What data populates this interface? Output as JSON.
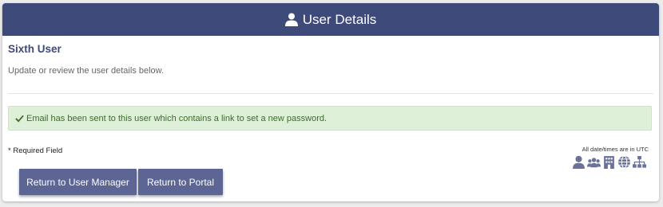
{
  "header": {
    "title": "User Details",
    "icon": "user-icon"
  },
  "user": {
    "name": "Sixth User",
    "description": "Update or review the user details below."
  },
  "alert": {
    "icon": "check-icon",
    "message": "Email has been sent to this user which contains a link to set a new password.",
    "background": "#dff0d8",
    "text_color": "#3c6a2f"
  },
  "form": {
    "required_note": "* Required Field",
    "utc_note": "All date/times are in UTC"
  },
  "toolbar_icons": [
    "user-icon",
    "users-group-icon",
    "building-icon",
    "globe-icon",
    "hierarchy-icon"
  ],
  "buttons": {
    "return_user_manager": "Return to User Manager",
    "return_portal": "Return to Portal"
  },
  "colors": {
    "primary": "#3e4a7a",
    "button": "#5c6593",
    "icon": "#6b7299"
  }
}
